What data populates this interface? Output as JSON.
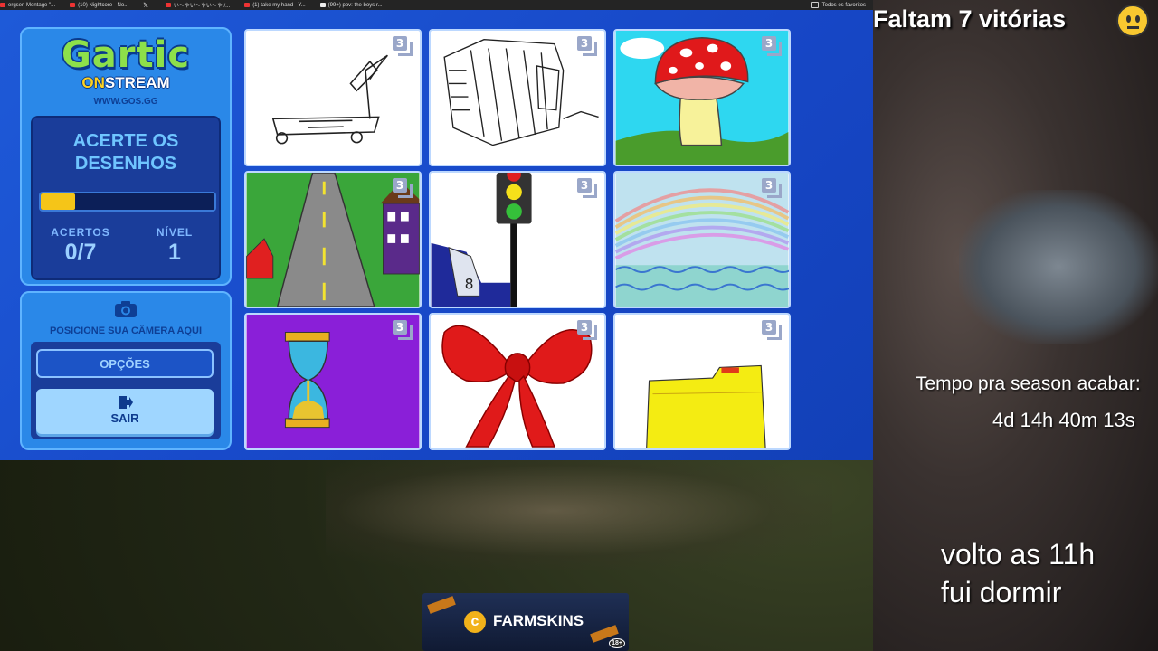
{
  "bookmarks": [
    {
      "label": "ergsen Montage \"...",
      "icon": "youtube-icon"
    },
    {
      "label": "(10) Nightcore - No...",
      "icon": "youtube-icon"
    },
    {
      "label": "",
      "icon": "x-icon"
    },
    {
      "label": "い〜やい〜やい〜や /...",
      "icon": "youtube-icon"
    },
    {
      "label": "(1) take my hand - Y...",
      "icon": "youtube-icon"
    },
    {
      "label": "(99+) pov: the boys r...",
      "icon": "tiktok-icon"
    }
  ],
  "bookmarks_all": "Todos os favoritos",
  "logo": {
    "title": "Gartic",
    "on": "ON",
    "stream": "STREAM",
    "url": "WWW.GOS.GG"
  },
  "panel": {
    "heading_line1": "ACERTE OS",
    "heading_line2": "DESENHOS",
    "progress_fraction": 0.2,
    "progress_color": "#f5c518",
    "acertos_label": "ACERTOS",
    "acertos_value": "0/7",
    "nivel_label": "NÍVEL",
    "nivel_value": "1"
  },
  "camera": {
    "text": "POSICIONE SUA CÂMERA AQUI"
  },
  "buttons": {
    "opcoes": "OPÇÕES",
    "sair": "SAIR"
  },
  "tiles": [
    {
      "name": "cart",
      "badge": "3"
    },
    {
      "name": "accordion",
      "badge": "3"
    },
    {
      "name": "mushroom",
      "badge": "3"
    },
    {
      "name": "road",
      "badge": "3"
    },
    {
      "name": "traffic-light",
      "badge": "3"
    },
    {
      "name": "rainbow",
      "badge": "3"
    },
    {
      "name": "hourglass",
      "badge": "3"
    },
    {
      "name": "bow",
      "badge": "3"
    },
    {
      "name": "folder",
      "badge": "3"
    }
  ],
  "overlay": {
    "faltam": "Faltam 7 vitórias",
    "season_label": "Tempo pra season acabar:",
    "season_time": "4d 14h 40m 13s",
    "volto_line1": "volto as 11h",
    "volto_line2": "fui dormir"
  },
  "sponsor": {
    "name": "FARMSKINS",
    "age": "18+"
  }
}
